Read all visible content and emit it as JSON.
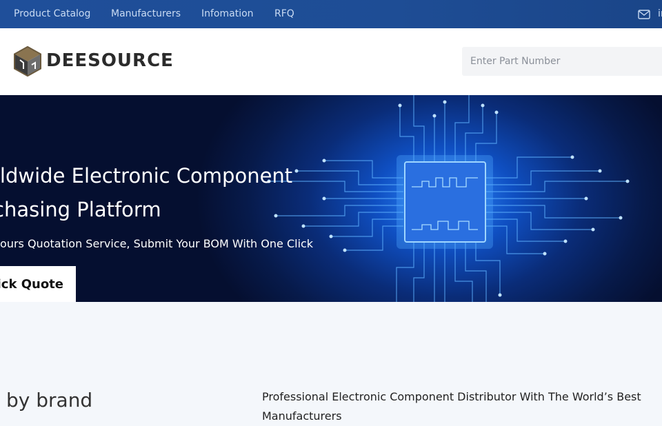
{
  "topnav": {
    "items": [
      "Product Catalog",
      "Manufacturers",
      "Infomation",
      "RFQ"
    ],
    "email_partial": "in"
  },
  "header": {
    "logo_text": "DEESOURCE",
    "logo_mark": "®",
    "search_placeholder": "Enter Part Number"
  },
  "hero": {
    "title_line1": "rldwide Electronic Component",
    "title_line2": "chasing Platform",
    "subtitle": "Hours Quotation Service, Submit Your BOM With One Click",
    "button_label": "ick Quote"
  },
  "section": {
    "brand_heading": "by brand",
    "distributor_text": "Professional Electronic Component Distributor With The World’s Best Manufacturers"
  },
  "colors": {
    "topbar": "#1e4d95",
    "nav_text": "#c9dbf3",
    "hero_glow": "#2f8cff",
    "chip": "#2a6fe0"
  }
}
